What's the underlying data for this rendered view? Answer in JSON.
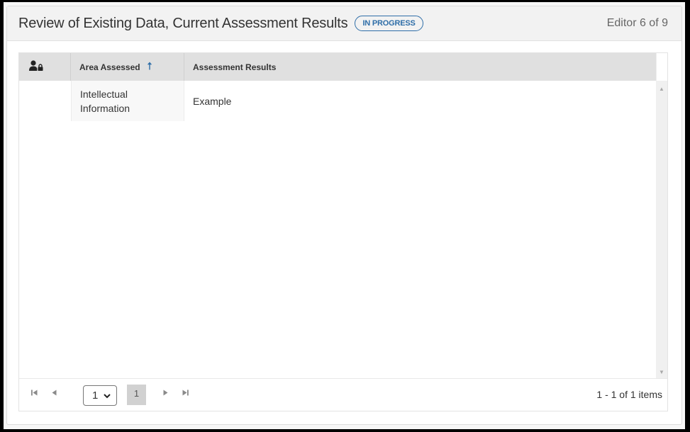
{
  "header": {
    "title": "Review of Existing Data, Current Assessment Results",
    "status_badge": "IN PROGRESS",
    "editor_count": "Editor 6 of 9"
  },
  "grid": {
    "columns": [
      {
        "key": "lock",
        "label": "",
        "icon": "user-lock-icon"
      },
      {
        "key": "area",
        "label": "Area Assessed",
        "sort": "ascending",
        "sort_icon": "arrow-up-icon"
      },
      {
        "key": "results",
        "label": "Assessment Results"
      }
    ],
    "rows": [
      {
        "lock": "",
        "area": "Intellectual Information",
        "results": "Example"
      }
    ]
  },
  "pager": {
    "page_size_selected": "1",
    "current_page": "1",
    "info": "1 - 1 of 1 items",
    "icons": {
      "first": "first-page-icon",
      "prev": "previous-page-icon",
      "next": "next-page-icon",
      "last": "last-page-icon"
    }
  },
  "colors": {
    "accent": "#2f6ea8",
    "header_bg": "#e0e0e0",
    "panel_header_bg": "#f2f2f2"
  }
}
